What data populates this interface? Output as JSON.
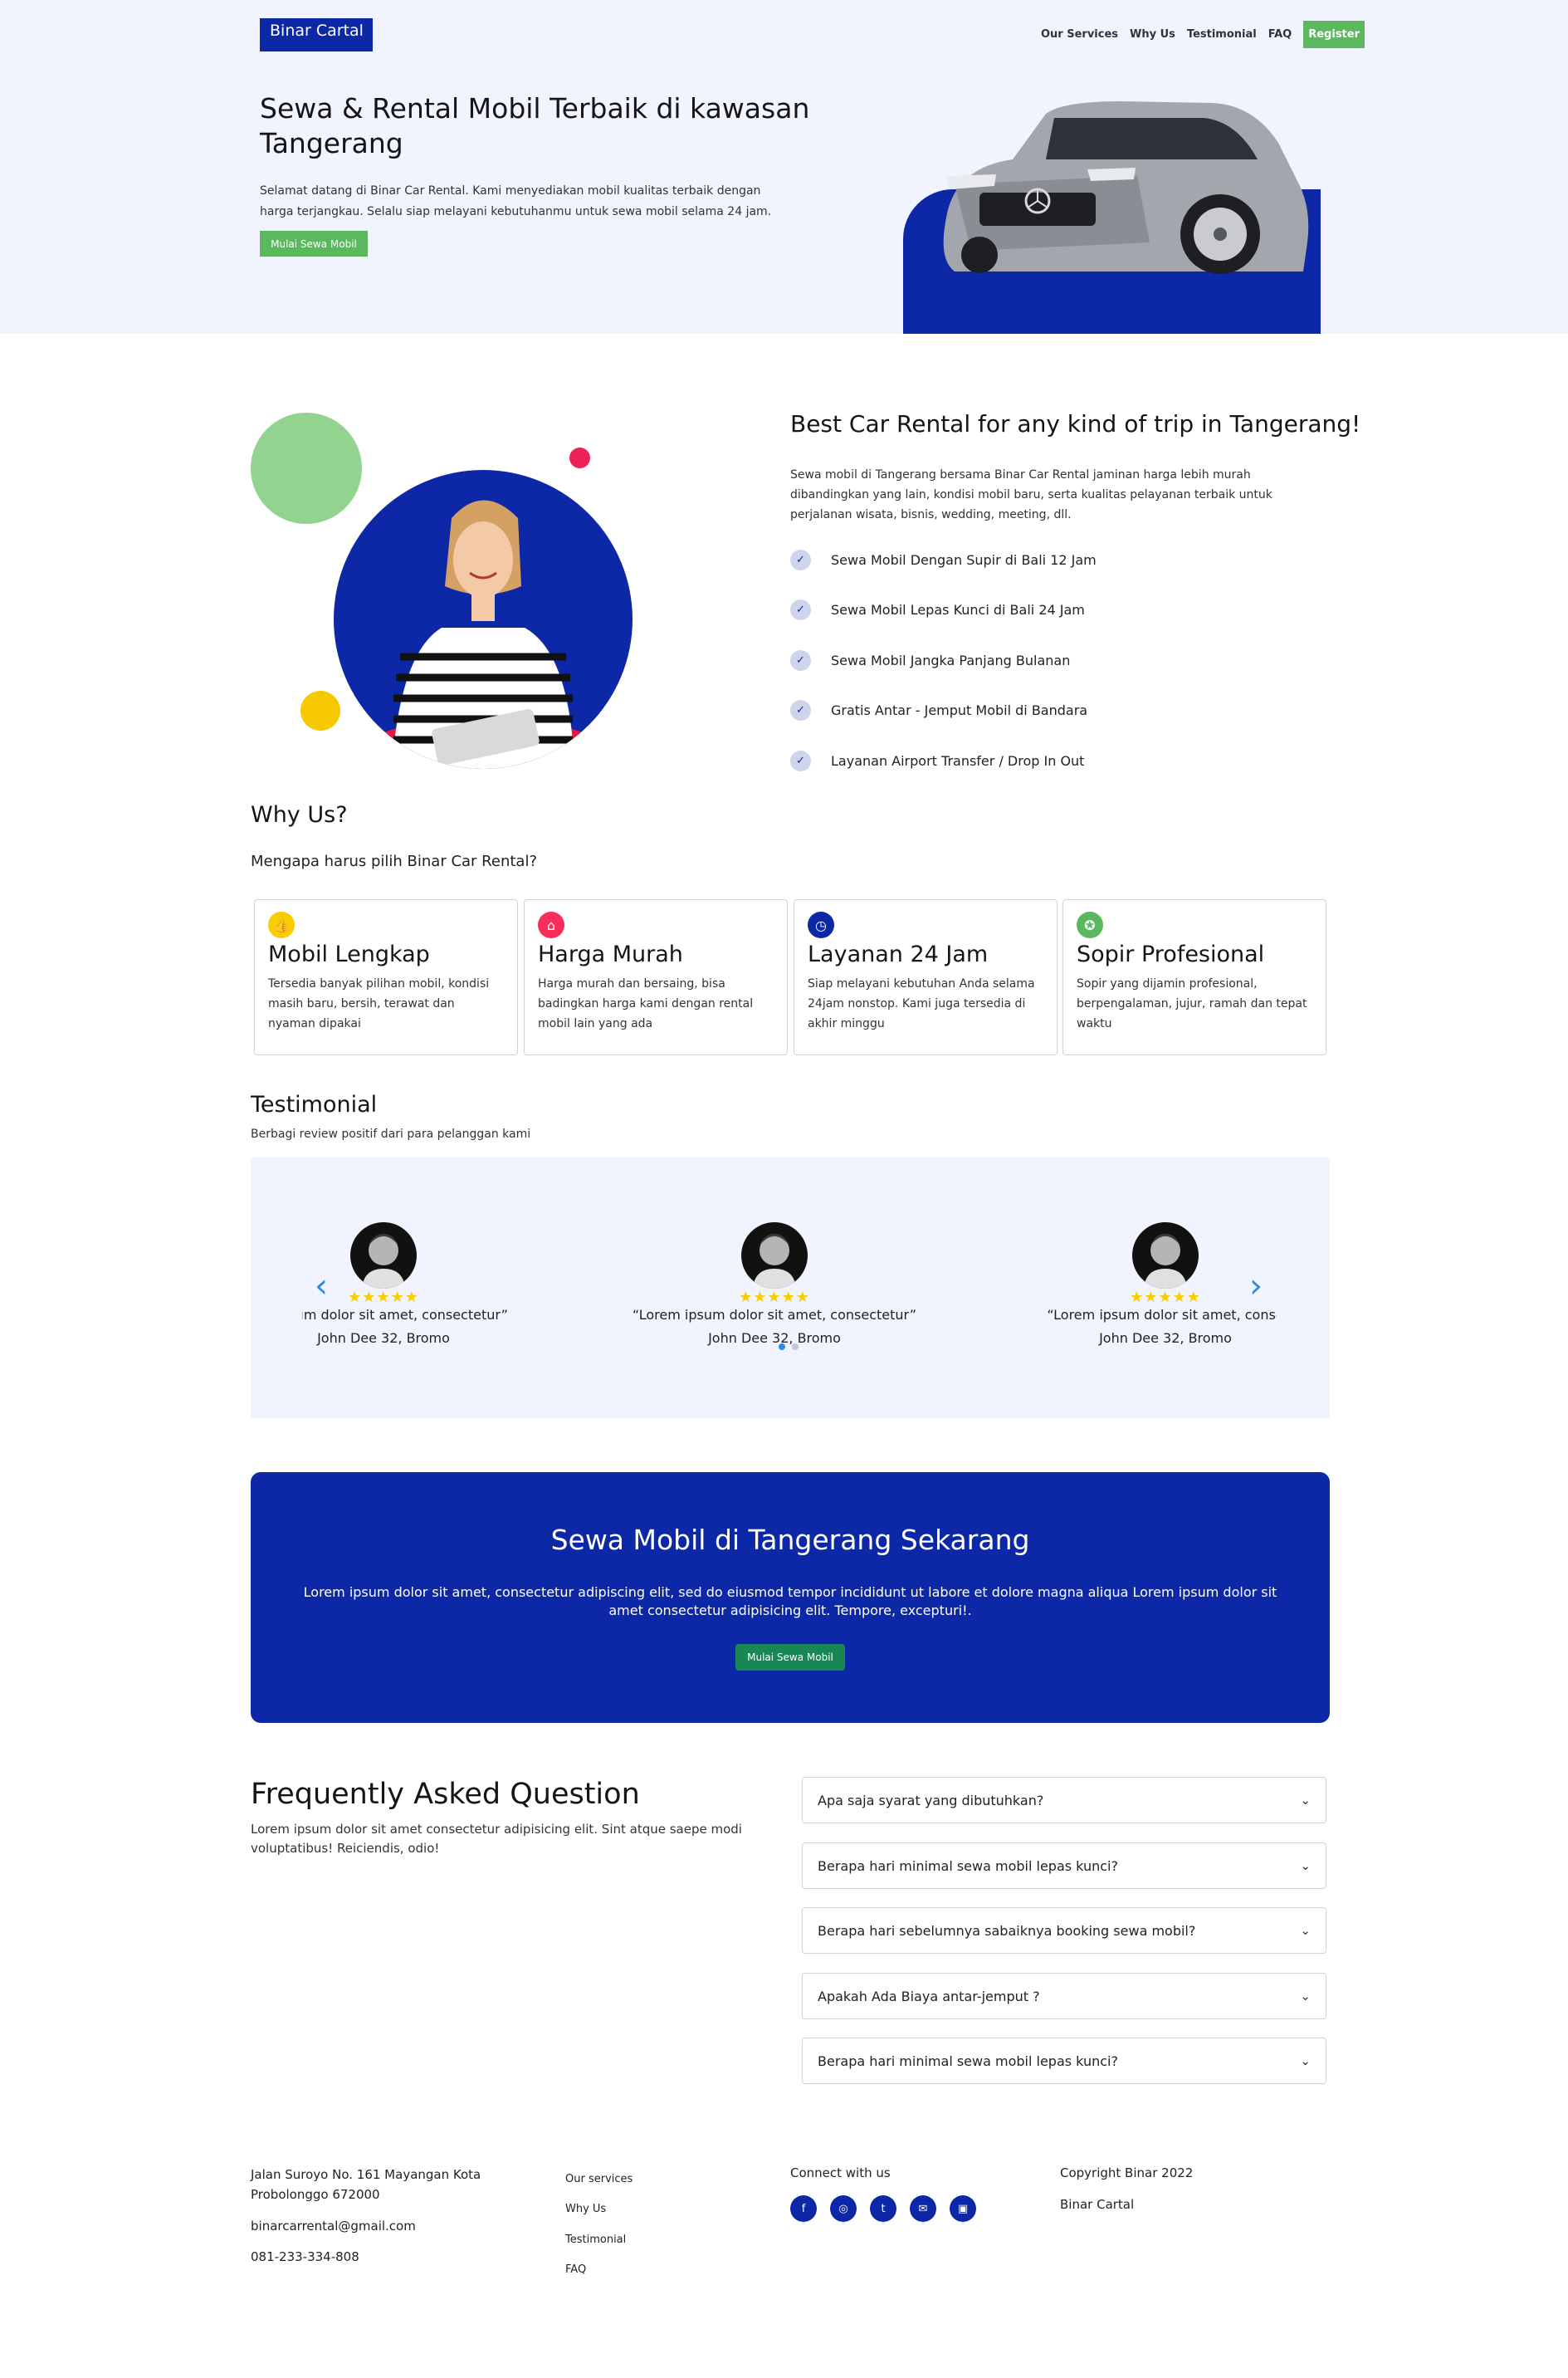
{
  "header": {
    "brand": "Binar Cartal",
    "nav": [
      "Our Services",
      "Why Us",
      "Testimonial",
      "FAQ"
    ],
    "register": "Register"
  },
  "hero": {
    "title": "Sewa & Rental Mobil Terbaik di kawasan Tangerang",
    "description": "Selamat datang di Binar Car Rental. Kami menyediakan mobil kualitas terbaik dengan harga terjangkau. Selalu siap melayani kebutuhanmu untuk sewa mobil selama 24 jam.",
    "cta": "Mulai Sewa Mobil"
  },
  "services": {
    "title": "Best Car Rental for any kind of trip in Tangerang!",
    "description": "Sewa mobil di Tangerang bersama Binar Car Rental jaminan harga lebih murah dibandingkan yang lain, kondisi mobil baru, serta kualitas pelayanan terbaik untuk perjalanan wisata, bisnis, wedding, meeting, dll.",
    "items": [
      "Sewa Mobil Dengan Supir di Bali 12 Jam",
      "Sewa Mobil Lepas Kunci di Bali 24 Jam",
      "Sewa Mobil Jangka Panjang Bulanan",
      "Gratis Antar - Jemput Mobil di Bandara",
      "Layanan Airport Transfer / Drop In Out"
    ]
  },
  "why_us": {
    "title": "Why Us?",
    "subtitle": "Mengapa harus pilih Binar Car Rental?",
    "cards": [
      {
        "icon": "thumbs-up-icon",
        "color": "#f9cc00",
        "title": "Mobil Lengkap",
        "desc": "Tersedia banyak pilihan mobil, kondisi masih baru, bersih, terawat dan nyaman dipakai"
      },
      {
        "icon": "tag-icon",
        "color": "#fa2c5a",
        "title": "Harga Murah",
        "desc": "Harga murah dan bersaing, bisa badingkan harga kami dengan rental mobil lain yang ada"
      },
      {
        "icon": "clock-icon",
        "color": "#0d28a6",
        "title": "Layanan 24 Jam",
        "desc": "Siap melayani kebutuhan Anda selama 24jam nonstop. Kami juga tersedia di akhir minggu"
      },
      {
        "icon": "award-icon",
        "color": "#5cb85f",
        "title": "Sopir Profesional",
        "desc": "Sopir yang dijamin profesional, berpengalaman, jujur, ramah dan tepat waktu"
      }
    ]
  },
  "testimonial": {
    "title": "Testimonial",
    "subtitle": "Berbagi review positif dari para pelanggan kami",
    "stars": "★★★★★",
    "rating": 5,
    "cards": [
      {
        "quote": "m ipsum dolor sit amet, consectetur”",
        "name": "John Dee 32, Bromo"
      },
      {
        "quote": "“Lorem ipsum dolor sit amet, consectetur”",
        "name": "John Dee 32, Bromo"
      },
      {
        "quote": "“Lorem ipsum dolor sit amet, conse",
        "name": "John Dee 32, Bromo"
      }
    ],
    "prev": "‹",
    "next": "›"
  },
  "cta_banner": {
    "title": "Sewa Mobil di Tangerang Sekarang",
    "description": "Lorem ipsum dolor sit amet, consectetur adipiscing elit, sed do eiusmod tempor incididunt ut labore et dolore magna aliqua Lorem ipsum dolor sit amet consectetur adipisicing elit. Tempore, excepturi!.",
    "button": "Mulai Sewa Mobil"
  },
  "faq": {
    "title": "Frequently Asked Question",
    "description": "Lorem ipsum dolor sit amet consectetur adipisicing elit. Sint atque saepe modi voluptatibus! Reiciendis, odio!",
    "questions": [
      "Apa saja syarat yang dibutuhkan?",
      "Berapa hari minimal sewa mobil lepas kunci?",
      "Berapa hari sebelumnya sabaiknya booking sewa mobil?",
      "Apakah Ada Biaya antar-jemput ?",
      "Berapa hari minimal sewa mobil lepas kunci?"
    ]
  },
  "footer": {
    "address": "Jalan Suroyo No. 161 Mayangan Kota Probolonggo 672000",
    "email": "binarcarrental@gmail.com",
    "phone": "081-233-334-808",
    "links": [
      "Our services",
      "Why Us",
      "Testimonial",
      "FAQ"
    ],
    "connect_label": "Connect with us",
    "social_icons": [
      "facebook-icon",
      "instagram-icon",
      "twitter-icon",
      "mail-icon",
      "twitch-icon"
    ],
    "copyright": "Copyright Binar 2022",
    "brand": "Binar Cartal"
  },
  "colors": {
    "primary": "#0d28a6",
    "green": "#5cb85f",
    "hero_bg": "#f1f3ff"
  }
}
